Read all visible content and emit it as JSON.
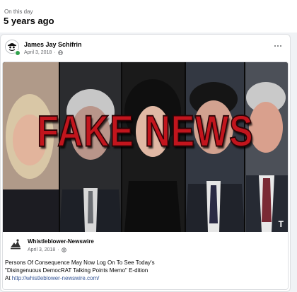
{
  "memory": {
    "label": "On this day",
    "years_ago": "5 years ago"
  },
  "post": {
    "author": "James Jay Schifrin",
    "date": "April 3, 2018",
    "audience_icon": "globe-icon",
    "more_icon": "more-options-icon",
    "image_headline": "FAKE NEWS",
    "image_watermark": "T",
    "shared": {
      "author": "Whistleblower-Newswire",
      "date": "April 3, 2018",
      "line1": "Persons Of Consequence May Now Log On To See Today's",
      "line2": "\"Disingenuous DemocRAT Talking Points Memo\" E-dition",
      "line3_prefix": "At",
      "link": "http://whistleblower-newswire.com/"
    }
  },
  "colors": {
    "headline_red": "#c2151d",
    "link_blue": "#385898",
    "online_green": "#31a24c"
  }
}
